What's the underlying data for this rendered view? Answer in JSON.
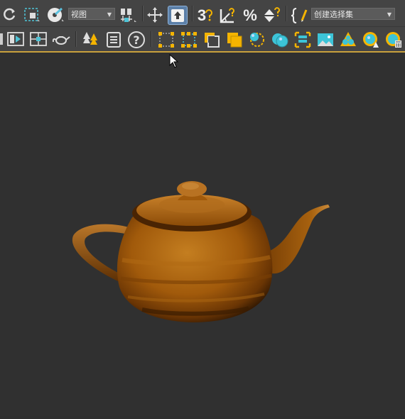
{
  "toolbar_top": {
    "view_dropdown": {
      "selected": "视图",
      "arrow": "▼"
    },
    "snap_3d_label": "3",
    "percent_glyph": "%",
    "selection_set_dropdown": {
      "selected": "创建选择集",
      "arrow": "▼"
    }
  },
  "toolbar_second": {
    "help_glyph": "?"
  },
  "icons": [
    "redo-icon",
    "select-region-icon",
    "select-by-name-icon",
    "view-dropdown",
    "pivot-icon",
    "move-icon",
    "select-manipulate-icon",
    "snap-3d-icon",
    "angle-snap-icon",
    "percent-snap-icon",
    "spinner-snap-icon",
    "edit-named-selection-icon",
    "selection-set-dropdown"
  ],
  "viewport": {
    "object": "teapot",
    "colors": {
      "body": "#9a5408",
      "highlight": "#c77a1a",
      "shadow": "#3a1c02",
      "background": "#303030"
    }
  },
  "colors": {
    "toolbar_bg": "#444444",
    "accent": "#f5b400",
    "cyan": "#3cc4d8",
    "active_button": "#5b7fa8",
    "divider_accent": "#c8a03c"
  }
}
